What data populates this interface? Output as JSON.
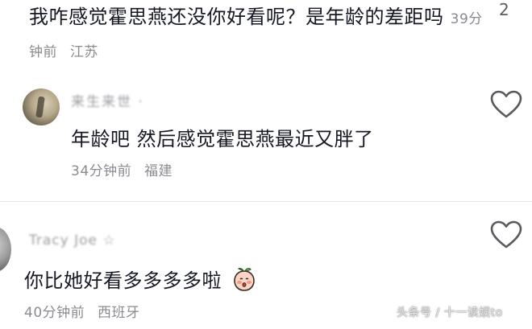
{
  "comment1": {
    "text": "我咋感觉霍思燕还没你好看呢？是年龄的差距吗",
    "time": "39分钟前",
    "location": "江苏",
    "like_count": "2"
  },
  "reply": {
    "username": "来生来世 ·",
    "text": "年龄吧 然后感觉霍思燕最近又胖了",
    "time": "34分钟前",
    "location": "福建"
  },
  "comment2": {
    "username": "Tracy Joe ☆",
    "text": "你比她好看多多多多啦",
    "time": "40分钟前",
    "location": "西班牙"
  },
  "watermark": "头条号 / 十一读娱to",
  "icons": {
    "like": "heart-outline-icon",
    "emoji": "peach-emoji-icon"
  },
  "colors": {
    "text": "#161823",
    "meta": "#8a8b91",
    "heart": "#5a5a60"
  }
}
